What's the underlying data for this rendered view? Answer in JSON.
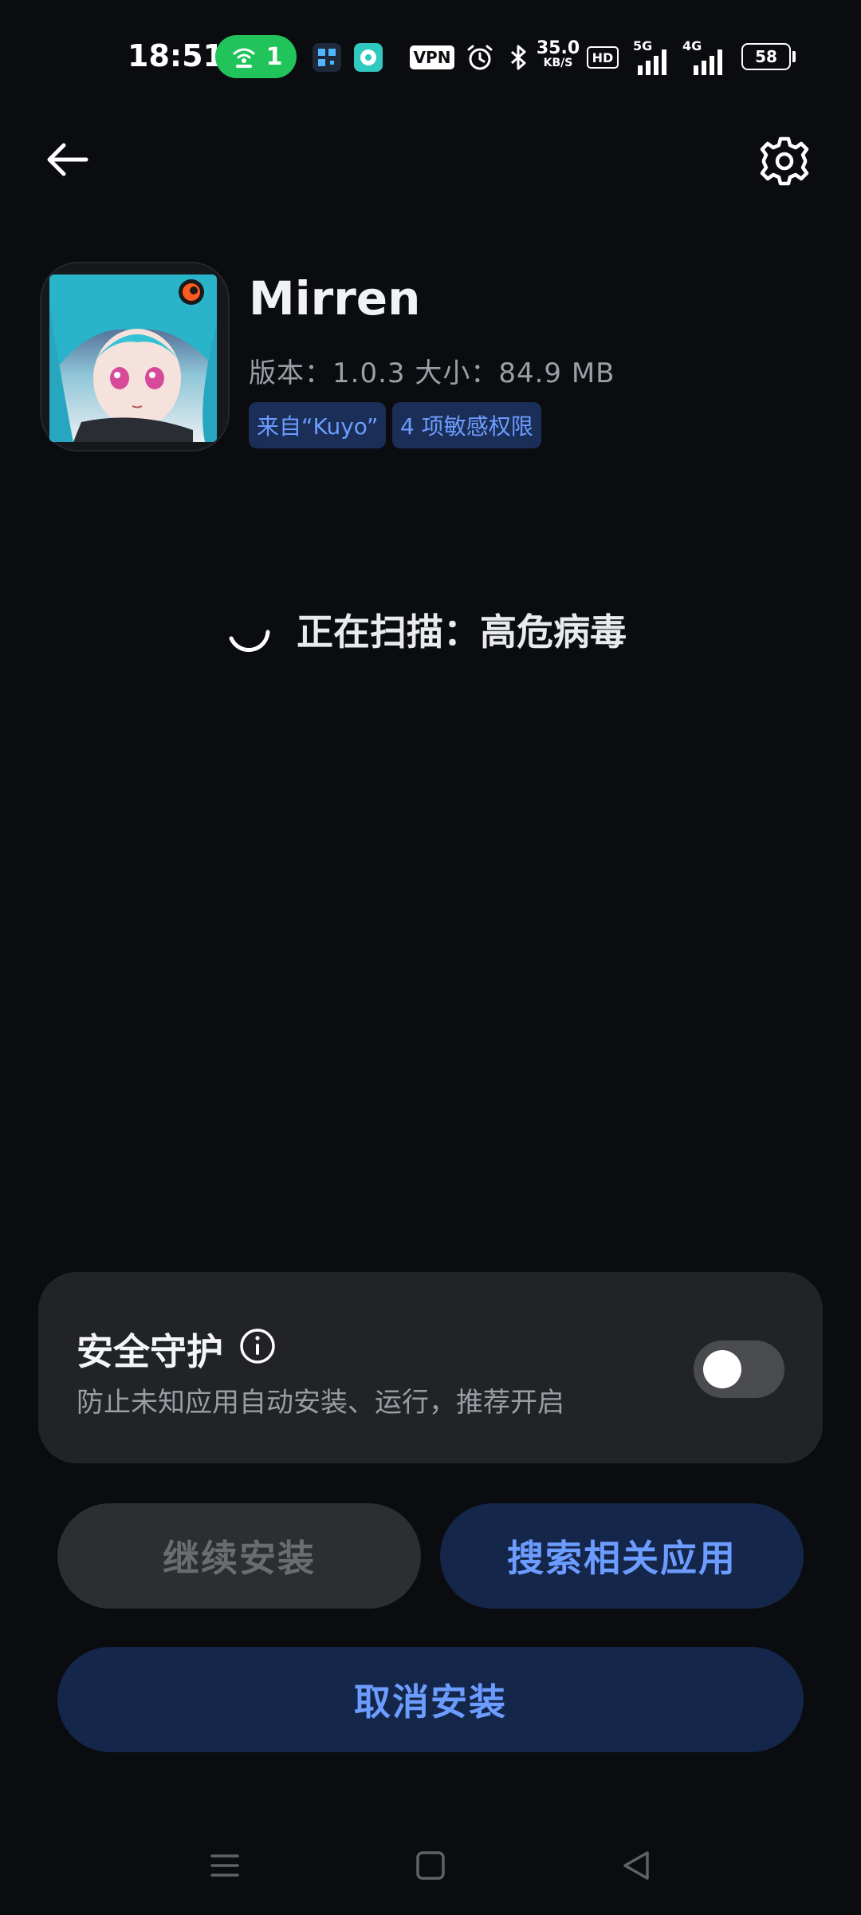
{
  "status_bar": {
    "time": "18:51",
    "hotspot_count": "1",
    "vpn_label": "VPN",
    "speed_value": "35.0",
    "speed_unit": "KB/S",
    "hd_label": "HD",
    "net_5g": "5G",
    "net_4g": "4G",
    "battery": "58",
    "icons": [
      "hotspot-icon",
      "qr-app-icon",
      "chat-app-icon",
      "vpn-icon",
      "alarm-icon",
      "bluetooth-icon",
      "hd-icon",
      "signal-5g-icon",
      "signal-4g-icon",
      "battery-icon"
    ]
  },
  "header": {
    "back_icon": "arrow-left-icon",
    "settings_icon": "gear-icon"
  },
  "app": {
    "name": "Mirren",
    "meta": "版本：1.0.3    大小：84.9 MB",
    "tags": [
      "来自“Kuyo”",
      "4 项敏感权限"
    ]
  },
  "scan": {
    "status": "正在扫描：高危病毒"
  },
  "security_card": {
    "title": "安全守护",
    "description": "防止未知应用自动安装、运行，推荐开启",
    "toggle_on": false
  },
  "buttons": {
    "continue": "继续安装",
    "search": "搜索相关应用",
    "cancel": "取消安装"
  },
  "nav": {
    "icons": [
      "menu-icon",
      "home-icon",
      "back-icon"
    ]
  },
  "colors": {
    "background": "#0b0c10",
    "accent": "#6c9cff",
    "accent_bg": "#14264a",
    "card": "#222327",
    "hotspot": "#21c45a"
  }
}
